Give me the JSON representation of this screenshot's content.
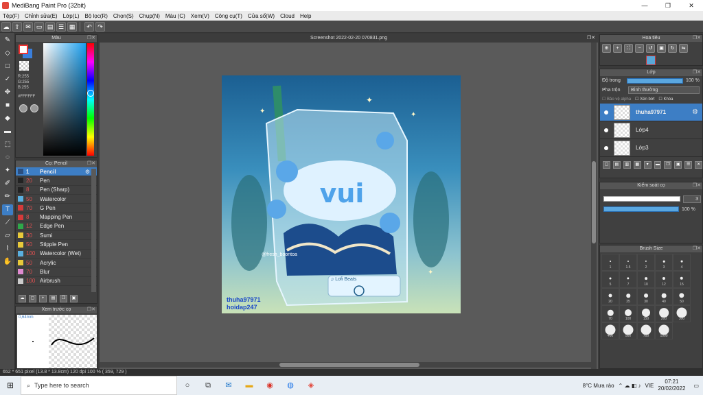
{
  "window": {
    "title": "MediBang Paint Pro (32bit)",
    "controls": [
      "—",
      "❐",
      "✕"
    ]
  },
  "menu": [
    "Tệp(F)",
    "Chỉnh sửa(E)",
    "Lớp(L)",
    "Bộ lọc(R)",
    "Chọn(S)",
    "Chụp(N)",
    "Màu (C)",
    "Xem(V)",
    "Công cụ(T)",
    "Cửa sổ(W)",
    "Cloud",
    "Help"
  ],
  "color_panel": {
    "title": "Màu",
    "r": "R:255",
    "g": "G:255",
    "b": "B:255",
    "hex": "#FFFFFF",
    "fg_color": "#ffffff",
    "bg_color": "#3a7fdc"
  },
  "brush_panel": {
    "title": "Cọ: Pencil",
    "brushes": [
      {
        "size": "1",
        "name": "Pencil",
        "color": "#2b4e7e",
        "selected": true
      },
      {
        "size": "20",
        "name": "Pen",
        "color": "#222222"
      },
      {
        "size": "8",
        "name": "Pen (Sharp)",
        "color": "#222222"
      },
      {
        "size": "50",
        "name": "Watercolor",
        "color": "#5ab0e0"
      },
      {
        "size": "70",
        "name": "G Pen",
        "color": "#d63a3a"
      },
      {
        "size": "8",
        "name": "Mapping Pen",
        "color": "#d63a3a"
      },
      {
        "size": "12",
        "name": "Edge Pen",
        "color": "#2fa84a"
      },
      {
        "size": "30",
        "name": "Sumi",
        "color": "#e8c93a"
      },
      {
        "size": "50",
        "name": "Stipple Pen",
        "color": "#e8c93a"
      },
      {
        "size": "100",
        "name": "Watercolor (Wet)",
        "color": "#5ab0e0"
      },
      {
        "size": "50",
        "name": "Acrylic",
        "color": "#e8c93a"
      },
      {
        "size": "70",
        "name": "Blur",
        "color": "#e08ad0"
      },
      {
        "size": "100",
        "name": "Airbrush",
        "color": "#cccccc"
      }
    ]
  },
  "preview_panel": {
    "title": "Xem trước cọ",
    "size_label": "0,64mm"
  },
  "document": {
    "tab_title": "Screenshot 2022-02-20 070831.png",
    "art_text_main": "vui",
    "art_handle": "@fresh_boontoa",
    "art_player": "♫ Lofi Beats",
    "watermark_line1": "thuha97971",
    "watermark_line2": "hoidap247"
  },
  "navigator": {
    "title": "Hoa tiêu"
  },
  "layer_panel": {
    "title": "Lớp",
    "opacity_label": "Độ trong",
    "opacity_value": "100 %",
    "blend_label": "Pha trộn",
    "blend_value": "Bình thường",
    "checks": [
      "Bảo vệ alpha",
      "Xén bớt",
      "Khóa"
    ],
    "layers": [
      {
        "name": "thuha97971",
        "selected": true
      },
      {
        "name": "Lớp4",
        "selected": false
      },
      {
        "name": "Lớp3",
        "selected": false
      }
    ]
  },
  "brush_control": {
    "title": "Kiểm soát cọ",
    "size_value": "3",
    "opacity_value": "100 %"
  },
  "brush_size": {
    "title": "Brush Size",
    "sizes": [
      "1",
      "1.5",
      "2",
      "3",
      "4",
      "5",
      "7",
      "10",
      "12",
      "15",
      "20",
      "25",
      "30",
      "40",
      "50",
      "70",
      "100",
      "150",
      "200",
      "300",
      "400",
      "500",
      "700",
      "1000"
    ]
  },
  "statusbar": "652 * 651 pixel   (13.8 * 13.8cm)   120 dpi   100 %   ( 359, 729 )",
  "taskbar": {
    "search_placeholder": "Type here to search",
    "weather": "8°C  Mưa rào",
    "lang": "VIE",
    "time": "07:21",
    "date": "20/02/2022"
  }
}
